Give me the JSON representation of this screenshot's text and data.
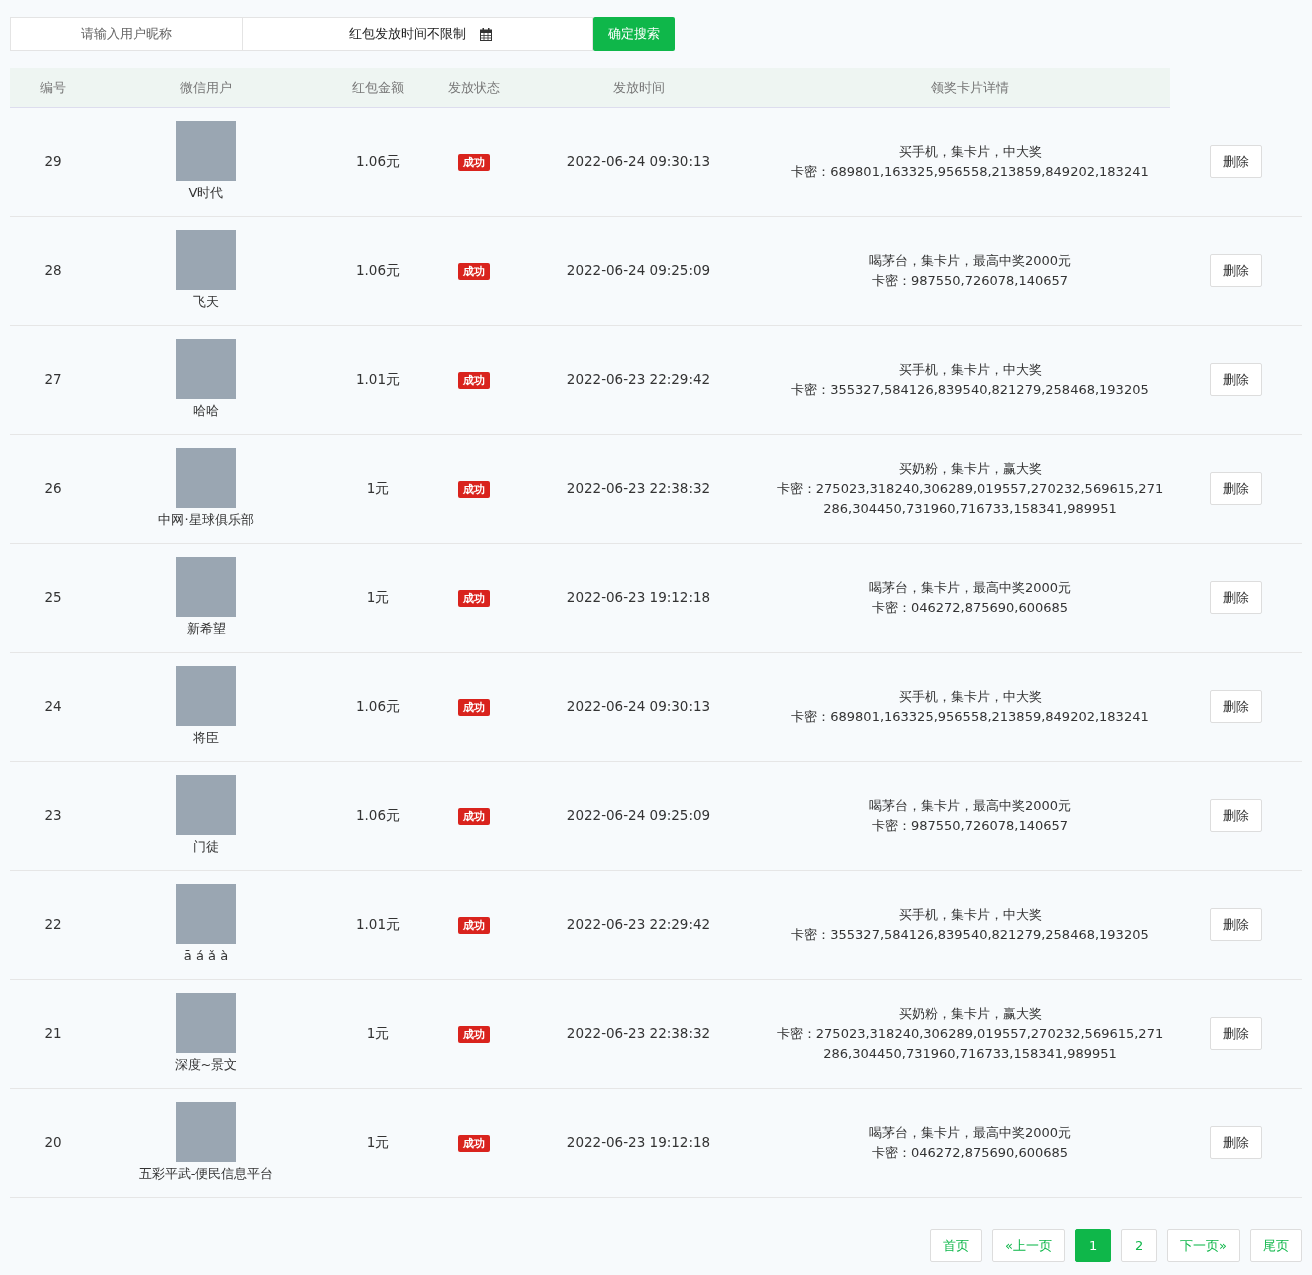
{
  "search": {
    "nickname_placeholder": "请输入用户昵称",
    "time_placeholder": "红包发放时间不限制",
    "button": "确定搜索"
  },
  "table": {
    "columns": [
      "编号",
      "微信用户",
      "红包金额",
      "发放状态",
      "发放时间",
      "领奖卡片详情"
    ],
    "rows": [
      {
        "id": "29",
        "user": "V时代",
        "amount": "1.06元",
        "status": "成功",
        "time": "2022-06-24 09:30:13",
        "title": "买手机，集卡片，中大奖",
        "cards": "卡密：689801,163325,956558,213859,849202,183241",
        "action": "删除"
      },
      {
        "id": "28",
        "user": "飞天",
        "amount": "1.06元",
        "status": "成功",
        "time": "2022-06-24 09:25:09",
        "title": "喝茅台，集卡片，最高中奖2000元",
        "cards": "卡密：987550,726078,140657",
        "action": "删除"
      },
      {
        "id": "27",
        "user": "哈哈",
        "amount": "1.01元",
        "status": "成功",
        "time": "2022-06-23 22:29:42",
        "title": "买手机，集卡片，中大奖",
        "cards": "卡密：355327,584126,839540,821279,258468,193205",
        "action": "删除"
      },
      {
        "id": "26",
        "user": "中网·星球俱乐部",
        "amount": "1元",
        "status": "成功",
        "time": "2022-06-23 22:38:32",
        "title": "买奶粉，集卡片，赢大奖",
        "cards": "卡密：275023,318240,306289,019557,270232,569615,271286,304450,731960,716733,158341,989951",
        "action": "删除"
      },
      {
        "id": "25",
        "user": "新希望",
        "amount": "1元",
        "status": "成功",
        "time": "2022-06-23 19:12:18",
        "title": "喝茅台，集卡片，最高中奖2000元",
        "cards": "卡密：046272,875690,600685",
        "action": "删除"
      },
      {
        "id": "24",
        "user": "将臣",
        "amount": "1.06元",
        "status": "成功",
        "time": "2022-06-24 09:30:13",
        "title": "买手机，集卡片，中大奖",
        "cards": "卡密：689801,163325,956558,213859,849202,183241",
        "action": "删除"
      },
      {
        "id": "23",
        "user": "门徒",
        "amount": "1.06元",
        "status": "成功",
        "time": "2022-06-24 09:25:09",
        "title": "喝茅台，集卡片，最高中奖2000元",
        "cards": "卡密：987550,726078,140657",
        "action": "删除"
      },
      {
        "id": "22",
        "user": "ā á ǎ à",
        "amount": "1.01元",
        "status": "成功",
        "time": "2022-06-23 22:29:42",
        "title": "买手机，集卡片，中大奖",
        "cards": "卡密：355327,584126,839540,821279,258468,193205",
        "action": "删除"
      },
      {
        "id": "21",
        "user": "深度~景文",
        "amount": "1元",
        "status": "成功",
        "time": "2022-06-23 22:38:32",
        "title": "买奶粉，集卡片，赢大奖",
        "cards": "卡密：275023,318240,306289,019557,270232,569615,271286,304450,731960,716733,158341,989951",
        "action": "删除"
      },
      {
        "id": "20",
        "user": "五彩平武-便民信息平台",
        "amount": "1元",
        "status": "成功",
        "time": "2022-06-23 19:12:18",
        "title": "喝茅台，集卡片，最高中奖2000元",
        "cards": "卡密：046272,875690,600685",
        "action": "删除"
      }
    ]
  },
  "pagination": [
    {
      "label": "首页",
      "selected": false
    },
    {
      "label": "«上一页",
      "selected": false
    },
    {
      "label": "1",
      "selected": true
    },
    {
      "label": "2",
      "selected": false
    },
    {
      "label": "下一页»",
      "selected": false
    },
    {
      "label": "尾页",
      "selected": false
    }
  ]
}
